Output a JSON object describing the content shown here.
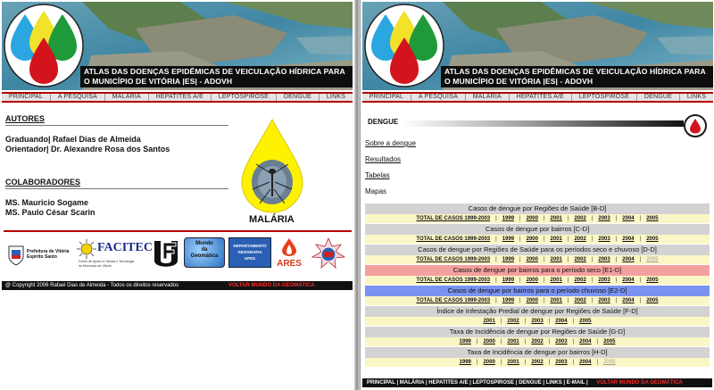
{
  "site": {
    "title_line1": "ATLAS DAS DOENÇAS EPIDÊMICAS DE VEICULAÇÃO HÍDRICA PARA",
    "title_line2": "O MUNICÍPIO DE VITÓRIA |ES| - ADOVH",
    "nav": [
      "PRINCIPAL",
      "A PESQUISA",
      "MALÁRIA",
      "HEPATITES A/E",
      "LEPTOSPIROSE",
      "DENGUE",
      "LINKS"
    ]
  },
  "left": {
    "authors_heading": "AUTORES",
    "authors_line1": "Graduando| Rafael Dias de Almeida",
    "authors_line2": "Orientador| Dr. Alexandre Rosa dos Santos",
    "collab_heading": "COLABORADORES",
    "collab_line1": "MS. Mauricio Sogame",
    "collab_line2": "MS. Paulo César Scarin",
    "malaria_label": "MALÁRIA",
    "logos": {
      "pmv": "Prefeitura de Vitória",
      "pmv2": "Espírito Santo",
      "facitec": "FACITEC",
      "facitec_sub1": "Fundo de Apoio à Ciência e Tecnologia",
      "facitec_sub2": "do Município de Vitória",
      "mundo1": "Mundo",
      "mundo2": "da",
      "mundo3": "Geomática",
      "depto1": "DEPARTAMENTO",
      "depto2": "GEOGRAFIA",
      "depto3": "UFES",
      "ares": "ARES"
    },
    "footer_copy": "@ Copyright 2006 Rafael Dias de Almeida - Todos os direitos reservados",
    "footer_back": "VOLTAR  MUNDO DA GEOMÁTICA"
  },
  "right": {
    "section_label": "DENGUE",
    "links": {
      "sobre": "Sobre a dengue",
      "resultados": "Resultados",
      "tabelas": "Tabelas",
      "mapas": "Mapas"
    },
    "sections": [
      {
        "title": "Casos de dengue por Regiões de Saúde [B-D]",
        "style": "gray",
        "years": [
          "TOTAL DE CASOS 1999-2003",
          "1999",
          "2000",
          "2001",
          "2002",
          "2003",
          "2004",
          "2005"
        ],
        "dim": []
      },
      {
        "title": "Casos de dengue por bairros [C-D]",
        "style": "gray",
        "years": [
          "TOTAL DE CASOS 1999-2003",
          "1999",
          "2000",
          "2001",
          "2002",
          "2003",
          "2004",
          "2005"
        ],
        "dim": []
      },
      {
        "title": "Casos de dengue por Regiões de Saúde para os períodos seco e chuvoso [D-D]",
        "style": "gray",
        "years": [
          "TOTAL DE CASOS 1999-2003",
          "1999",
          "2000",
          "2001",
          "2002",
          "2003",
          "2004",
          "2005"
        ],
        "dim": [
          "2005"
        ]
      },
      {
        "title": "Casos de dengue por bairros para o período seco [E1-D]",
        "style": "red",
        "years": [
          "TOTAL DE CASOS 1999-2003",
          "1999",
          "2000",
          "2001",
          "2002",
          "2003",
          "2004",
          "2005"
        ],
        "dim": []
      },
      {
        "title": "Casos de dengue por bairros para o período chuvoso [E2-D]",
        "style": "blue",
        "years": [
          "TOTAL DE CASOS 1999-2003",
          "1999",
          "2000",
          "2001",
          "2002",
          "2003",
          "2004",
          "2005"
        ],
        "dim": []
      },
      {
        "title": "Índice de Infestação Predial de dengue por Regiões de Saúde [F-D]",
        "style": "gray",
        "years": [
          "2001",
          "2002",
          "2003",
          "2004",
          "2005"
        ],
        "dim": []
      },
      {
        "title": "Taxa de Incidência de dengue por Regiões de Saúde [G-D]",
        "style": "gray",
        "years": [
          "1999",
          "2000",
          "2001",
          "2002",
          "2003",
          "2004",
          "2005"
        ],
        "dim": []
      },
      {
        "title": "Taxa de Incidência de dengue por bairros [H-D]",
        "style": "gray",
        "years": [
          "1999",
          "2000",
          "2001",
          "2002",
          "2003",
          "2004",
          "2005"
        ],
        "dim": [
          "2005"
        ]
      }
    ],
    "footer_links": "PRINCIPAL | MALÁRIA | HEPATITES A/E | LEPTOSPIROSE | DENGUE | LINKS | E-MAIL |",
    "footer_back": "VOLTAR  MUNDO DA GEOMÁTICA"
  },
  "colors": {
    "accent_red": "#b40000",
    "drop_blue": "#2aa7e0",
    "drop_yellow": "#f2e22a",
    "drop_green": "#1f9a3a",
    "drop_red": "#d4141c",
    "highlight_red": "#f5a0a0",
    "highlight_blue": "#7a93f2",
    "year_row_bg": "#fbf6c5"
  },
  "icons": {
    "logo": "water-drops-logo-icon",
    "dengue": "blood-drop-icon",
    "malaria": "mosquito-drop-icon"
  }
}
